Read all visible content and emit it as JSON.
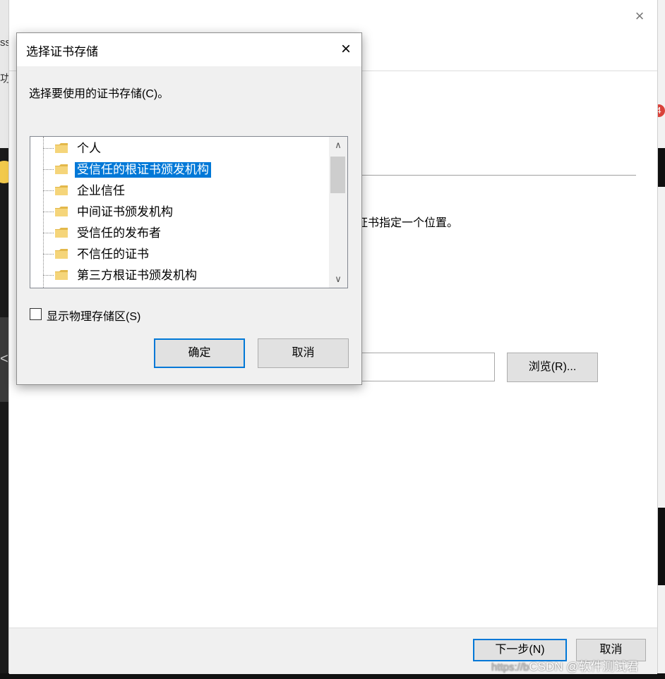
{
  "background": {
    "left_glyphs": [
      "ss",
      "功",
      "<"
    ],
    "notification_count": "4"
  },
  "wizard": {
    "close_icon": "×",
    "location_text": "证书指定一个位置。",
    "browse_label": "浏览(R)...",
    "next_label": "下一步(N)",
    "cancel_label": "取消"
  },
  "dialog": {
    "title": "选择证书存储",
    "close_icon": "×",
    "prompt": "选择要使用的证书存储(C)。",
    "tree_items": [
      {
        "label": "个人",
        "selected": false
      },
      {
        "label": "受信任的根证书颁发机构",
        "selected": true
      },
      {
        "label": "企业信任",
        "selected": false
      },
      {
        "label": "中间证书颁发机构",
        "selected": false
      },
      {
        "label": "受信任的发布者",
        "selected": false
      },
      {
        "label": "不信任的证书",
        "selected": false
      },
      {
        "label": "第三方根证书颁发机构",
        "selected": false
      }
    ],
    "scroll_up_icon": "∧",
    "scroll_down_icon": "∨",
    "show_physical_label": "显示物理存储区(S)",
    "show_physical_checked": false,
    "ok_label": "确定",
    "cancel_label": "取消"
  },
  "watermark": {
    "prefix": "https://b",
    "text": "CSDN @软件测试君"
  },
  "colors": {
    "accent": "#0078d7",
    "folder": "#f5d57a"
  }
}
